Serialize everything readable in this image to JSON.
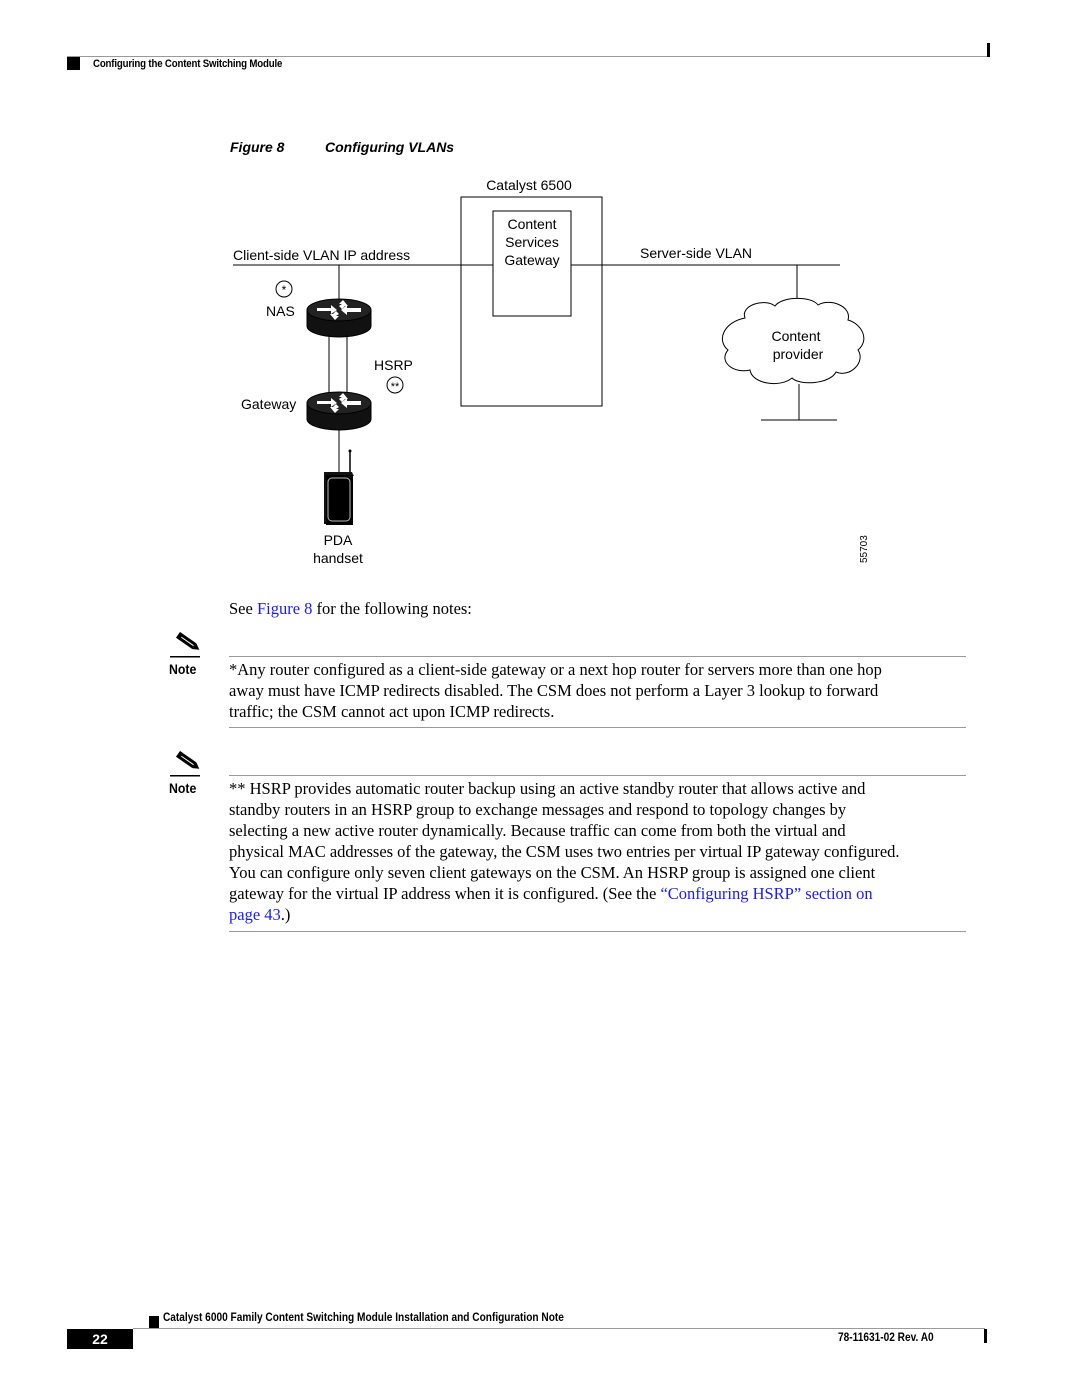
{
  "header": {
    "section_title": "Configuring the Content Switching Module"
  },
  "figure": {
    "number": "Figure 8",
    "title": "Configuring VLANs",
    "labels": {
      "catalyst": "Catalyst 6500",
      "csg_line1": "Content",
      "csg_line2": "Services",
      "csg_line3": "Gateway",
      "client_vlan": "Client-side VLAN IP address",
      "server_vlan": "Server-side VLAN",
      "nas_marker": "*",
      "nas": "NAS",
      "hsrp": "HSRP",
      "hsrp_marker": "**",
      "gateway": "Gateway",
      "cloud_line1": "Content",
      "cloud_line2": "provider",
      "pda_line1": "PDA",
      "pda_line2": "handset",
      "figure_id": "55703"
    },
    "icons": [
      "router-icon",
      "router-icon",
      "pda-handset-icon",
      "cloud-icon"
    ]
  },
  "body": {
    "see_prefix": "See ",
    "see_link": "Figure 8",
    "see_suffix": " for the following notes:"
  },
  "notes": [
    {
      "label": "Note",
      "icon": "pencil-icon",
      "lines": [
        "*Any router configured as a client-side gateway or a next hop router for servers more than one hop",
        "away must have ICMP redirects disabled. The CSM does not perform a Layer 3 lookup to forward",
        "traffic; the CSM cannot act upon ICMP redirects."
      ]
    },
    {
      "label": "Note",
      "icon": "pencil-icon",
      "lines": [
        "** HSRP provides automatic router backup using an active standby router that allows active and",
        "standby routers in an HSRP group to exchange messages and respond to topology changes by",
        "selecting a new active router dynamically. Because traffic can come from both the virtual and",
        "physical MAC addresses of the gateway, the CSM uses two entries per virtual IP gateway configured.",
        "You can configure only seven client gateways on the CSM. An HSRP group is assigned one client"
      ],
      "last_line_prefix": "gateway for the virtual IP address when it is configured. (See the ",
      "link_text_1": "“Configuring HSRP” section on",
      "link_text_2": "page 43",
      "last_suffix": ".)"
    }
  ],
  "footer": {
    "doc_title": "Catalyst 6000 Family Content Switching Module Installation and Configuration Note",
    "page_number": "22",
    "doc_number": "78-11631-02 Rev. A0"
  }
}
